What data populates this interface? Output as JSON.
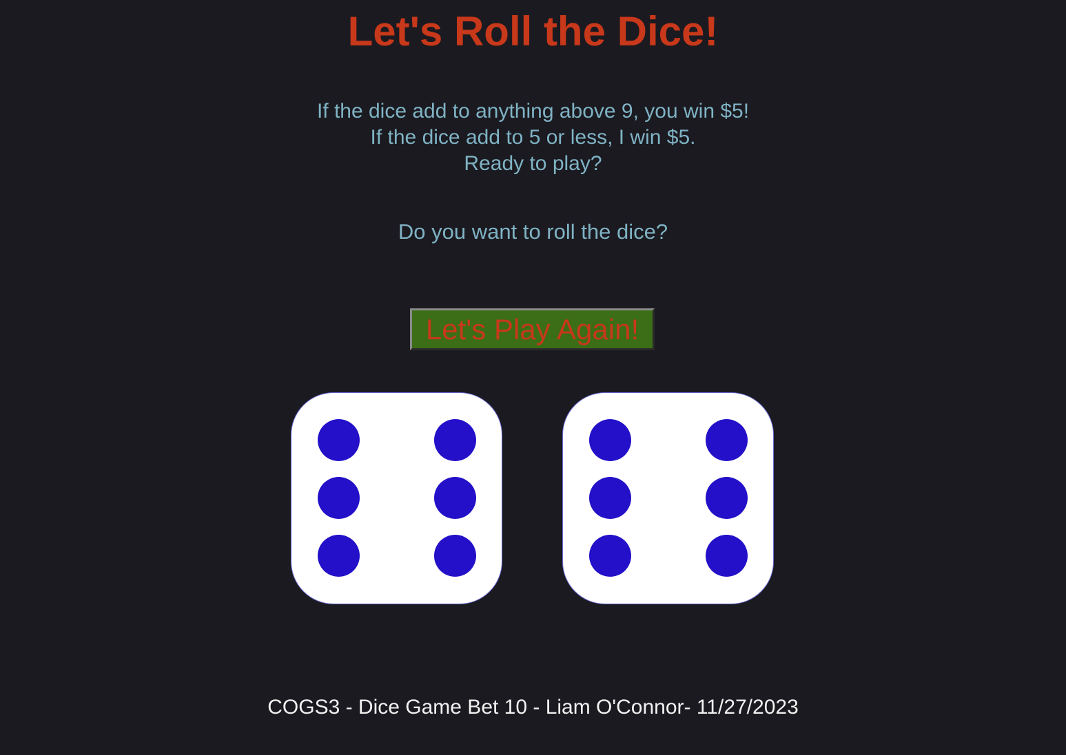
{
  "header": {
    "title": "Let's Roll the Dice!"
  },
  "rules": {
    "line1": "If the dice add to anything above 9, you win $5!",
    "line2": "If the dice add to 5 or less, I win $5.",
    "line3": "Ready to play?"
  },
  "prompt": {
    "question": "Do you want to roll the dice?"
  },
  "controls": {
    "play_again_label": "Let's Play Again!"
  },
  "dice": {
    "left_value": 6,
    "right_value": 6,
    "pip_color": "#2310c8",
    "face_color": "#ffffff"
  },
  "footer": {
    "credit": "COGS3 - Dice Game Bet 10 - Liam O'Connor- 11/27/2023"
  },
  "colors": {
    "background": "#1b1a20",
    "title": "#c8381a",
    "text_accent": "#7fb3c4",
    "button_bg": "#3b6e16"
  }
}
